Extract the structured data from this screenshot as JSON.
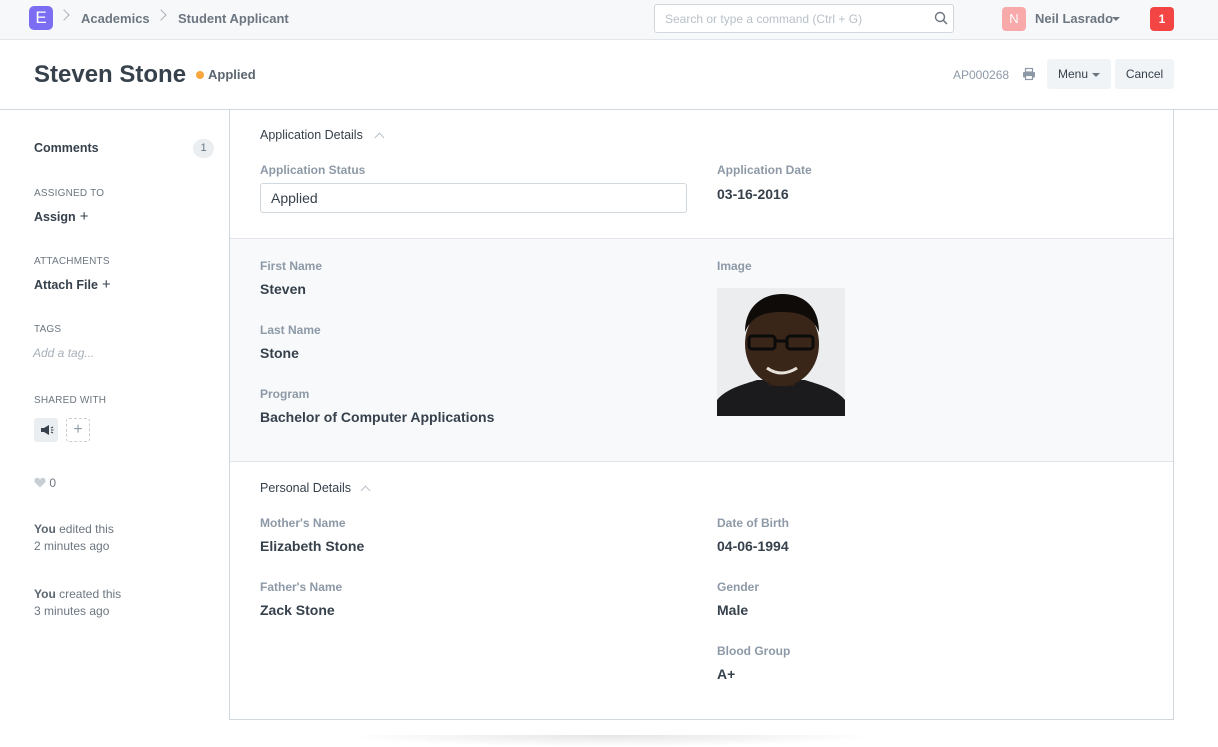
{
  "nav": {
    "logo_letter": "E",
    "breadcrumbs": [
      "Academics",
      "Student Applicant"
    ],
    "search_placeholder": "Search or type a command (Ctrl + G)",
    "user_initial": "N",
    "user_name": "Neil Lasrado",
    "notification_count": "1"
  },
  "header": {
    "title": "Steven Stone",
    "status": "Applied",
    "doc_name": "AP000268",
    "menu_label": "Menu",
    "cancel_label": "Cancel"
  },
  "sidebar": {
    "comments_label": "Comments",
    "comments_count": "1",
    "assigned_to_label": "ASSIGNED TO",
    "assign_label": "Assign",
    "attachments_label": "ATTACHMENTS",
    "attach_label": "Attach File",
    "tags_label": "TAGS",
    "tag_placeholder": "Add a tag...",
    "shared_with_label": "SHARED WITH",
    "likes_count": "0",
    "timeline": [
      {
        "who": "You",
        "action": "edited this",
        "when": "2 minutes ago"
      },
      {
        "who": "You",
        "action": "created this",
        "when": "3 minutes ago"
      }
    ]
  },
  "form": {
    "application_details": {
      "heading": "Application Details",
      "status_label": "Application Status",
      "status_value": "Applied",
      "date_label": "Application Date",
      "date_value": "03-16-2016"
    },
    "student": {
      "first_name_label": "First Name",
      "first_name": "Steven",
      "last_name_label": "Last Name",
      "last_name": "Stone",
      "program_label": "Program",
      "program": "Bachelor of Computer Applications",
      "image_label": "Image"
    },
    "personal_details": {
      "heading": "Personal Details",
      "mother_label": "Mother's Name",
      "mother": "Elizabeth Stone",
      "father_label": "Father's Name",
      "father": "Zack Stone",
      "dob_label": "Date of Birth",
      "dob": "04-06-1994",
      "gender_label": "Gender",
      "gender": "Male",
      "blood_label": "Blood Group",
      "blood": "A+"
    }
  },
  "colors": {
    "logo": "#7b6ef2",
    "status_dot": "#f8a73e",
    "notification": "#f44545",
    "avatar": "#f8a9a9"
  }
}
